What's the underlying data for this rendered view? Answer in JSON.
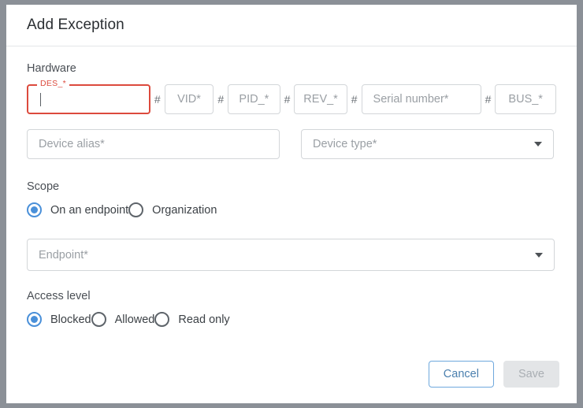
{
  "dialog": {
    "title": "Add Exception"
  },
  "hardware": {
    "label": "Hardware",
    "separator": "#",
    "fields": [
      {
        "name": "des",
        "label": "DES_*",
        "value": "",
        "state": "invalid-focused"
      },
      {
        "name": "vid",
        "label": "VID*",
        "value": "",
        "state": "default"
      },
      {
        "name": "pid",
        "label": "PID_*",
        "value": "",
        "state": "default"
      },
      {
        "name": "rev",
        "label": "REV_*",
        "value": "",
        "state": "default"
      },
      {
        "name": "serial",
        "label": "Serial number*",
        "value": "",
        "state": "default"
      },
      {
        "name": "bus",
        "label": "BUS_*",
        "value": "",
        "state": "default"
      }
    ],
    "device_alias": {
      "placeholder": "Device alias*",
      "value": ""
    },
    "device_type": {
      "placeholder": "Device type*",
      "value": "",
      "icon": "chevron-down-icon"
    }
  },
  "scope": {
    "label": "Scope",
    "options": [
      {
        "label": "On an endpoint",
        "selected": true
      },
      {
        "label": "Organization",
        "selected": false
      }
    ]
  },
  "endpoint": {
    "placeholder": "Endpoint*",
    "value": "",
    "icon": "chevron-down-icon"
  },
  "access_level": {
    "label": "Access level",
    "options": [
      {
        "label": "Blocked",
        "selected": true
      },
      {
        "label": "Allowed",
        "selected": false
      },
      {
        "label": "Read only",
        "selected": false
      }
    ]
  },
  "footer": {
    "cancel_label": "Cancel",
    "save_label": "Save",
    "save_disabled": true
  },
  "colors": {
    "accent": "#4a90d9",
    "error": "#dc4a3d",
    "text": "#2b2f33",
    "placeholder": "#9a9fa4",
    "border": "#d3d6d9",
    "backdrop": "#8b9097"
  }
}
